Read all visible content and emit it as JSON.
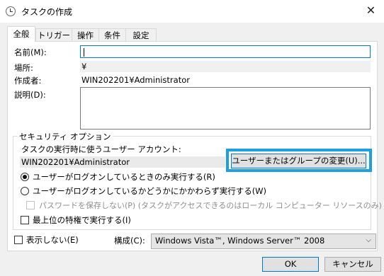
{
  "window": {
    "title": "タスクの作成",
    "close_label": "✕"
  },
  "tabs": [
    {
      "label": "全般",
      "active": true
    },
    {
      "label": "トリガー"
    },
    {
      "label": "操作"
    },
    {
      "label": "条件"
    },
    {
      "label": "設定"
    }
  ],
  "general": {
    "name_label": "名前(M):",
    "name_value": "",
    "location_label": "場所:",
    "location_value": "¥",
    "author_label": "作成者:",
    "author_value": "WIN202201¥Administrator",
    "description_label": "説明(D):",
    "description_value": ""
  },
  "security": {
    "group_label": "セキュリティ オプション",
    "account_prompt": "タスクの実行時に使うユーザー アカウント:",
    "account_value": "WIN202201¥Administrator",
    "change_button": "ユーザーまたはグループの変更(U)...",
    "radio_logged_on": "ユーザーがログオンしているときのみ実行する(R)",
    "radio_any": "ユーザーがログオンしているかどうかにかかわらず実行する(W)",
    "no_store_password": "パスワードを保存しない(P) (タスクがアクセスできるのはローカル コンピューター リソースのみ)",
    "highest_privileges": "最上位の特権で実行する(I)",
    "selected_radio": "logged_on"
  },
  "footer": {
    "hidden_label": "表示しない(E)",
    "configure_label": "構成(C):",
    "configure_value": "Windows Vista™, Windows Server™ 2008",
    "ok_button": "OK",
    "cancel_button": "キャンセル"
  },
  "highlight_color": "#1ba1e2"
}
